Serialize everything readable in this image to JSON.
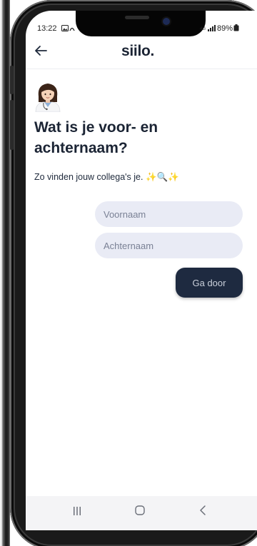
{
  "status_bar": {
    "time": "13:22",
    "battery": "89%"
  },
  "header": {
    "brand": "siilo."
  },
  "main": {
    "heading": "Wat is je voor- en achternaam?",
    "subtitle": "Zo vinden jouw collega's je. ✨🔍✨",
    "first_name": {
      "placeholder": "Voornaam",
      "value": ""
    },
    "last_name": {
      "placeholder": "Achternaam",
      "value": ""
    },
    "next_button": "Ga door"
  },
  "icons": {
    "back": "back-arrow-icon",
    "avatar": "doctor-woman-emoji",
    "nav": [
      "recent-apps-icon",
      "home-icon",
      "back-icon"
    ]
  },
  "colors": {
    "primary_dark": "#1e2a40",
    "input_bg": "#e9ebf5",
    "text": "#1b2434"
  }
}
